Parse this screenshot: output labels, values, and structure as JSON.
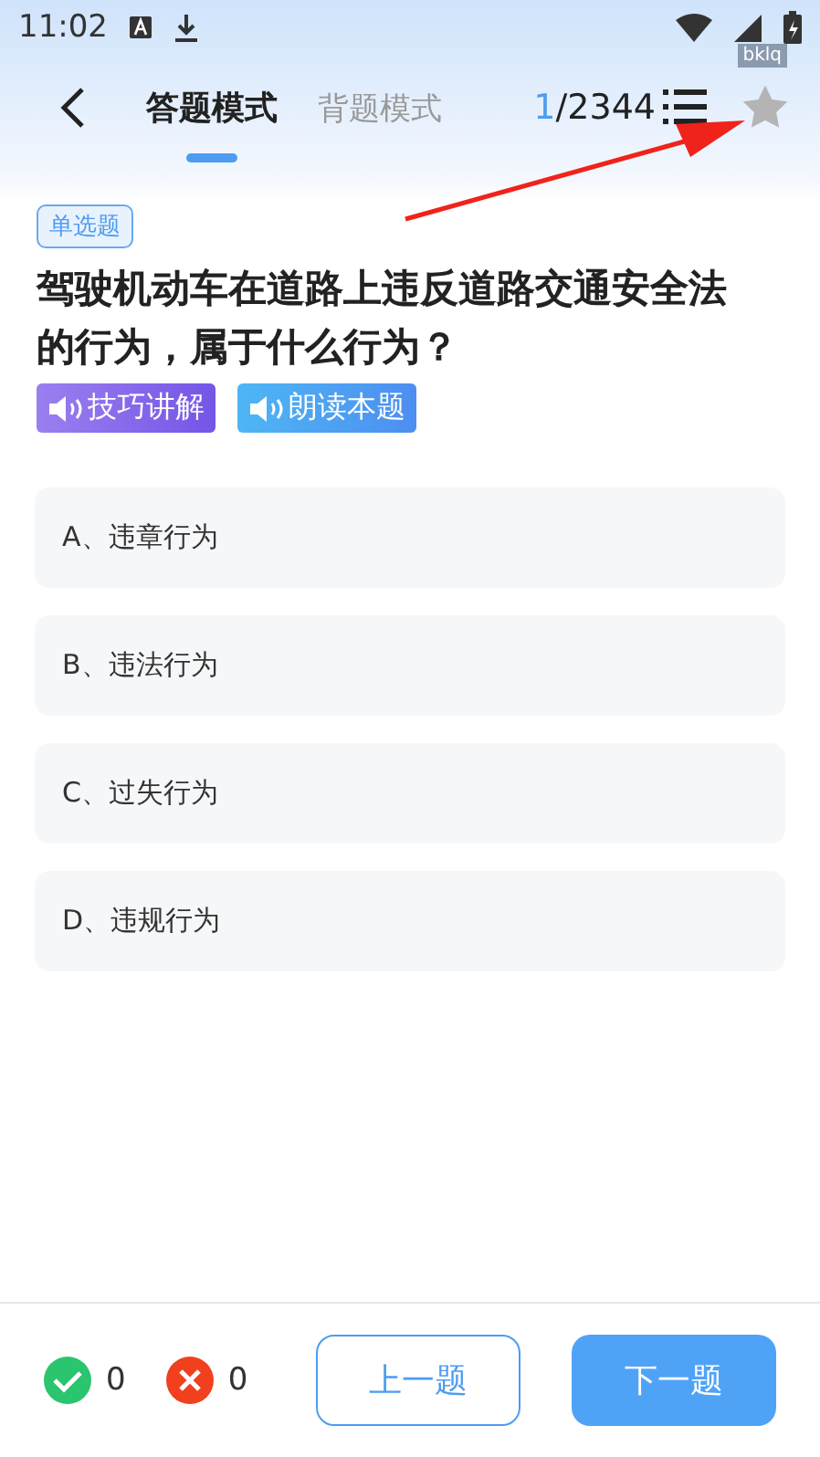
{
  "status_bar": {
    "time": "11:02"
  },
  "header": {
    "tabs": [
      {
        "label": "答题模式",
        "selected": true
      },
      {
        "label": "背题模式",
        "selected": false
      }
    ],
    "counter": {
      "current": "1",
      "total": "/2344"
    },
    "favorite": {
      "checked": false
    },
    "tooltip": "bklq"
  },
  "question": {
    "type_tag": "单选题",
    "text": "驾驶机动车在道路上违反道路交通安全法的行为，属于什么行为？",
    "actions": [
      {
        "label": "技巧讲解",
        "kind": "explain"
      },
      {
        "label": "朗读本题",
        "kind": "read"
      }
    ],
    "options": [
      {
        "label": "A、违章行为",
        "selected": false
      },
      {
        "label": "B、违法行为",
        "selected": false
      },
      {
        "label": "C、过失行为",
        "selected": false
      },
      {
        "label": "D、违规行为",
        "selected": false
      }
    ]
  },
  "footer": {
    "correct_count": "0",
    "wrong_count": "0",
    "prev_button": "上一题",
    "next_button": "下一题"
  }
}
